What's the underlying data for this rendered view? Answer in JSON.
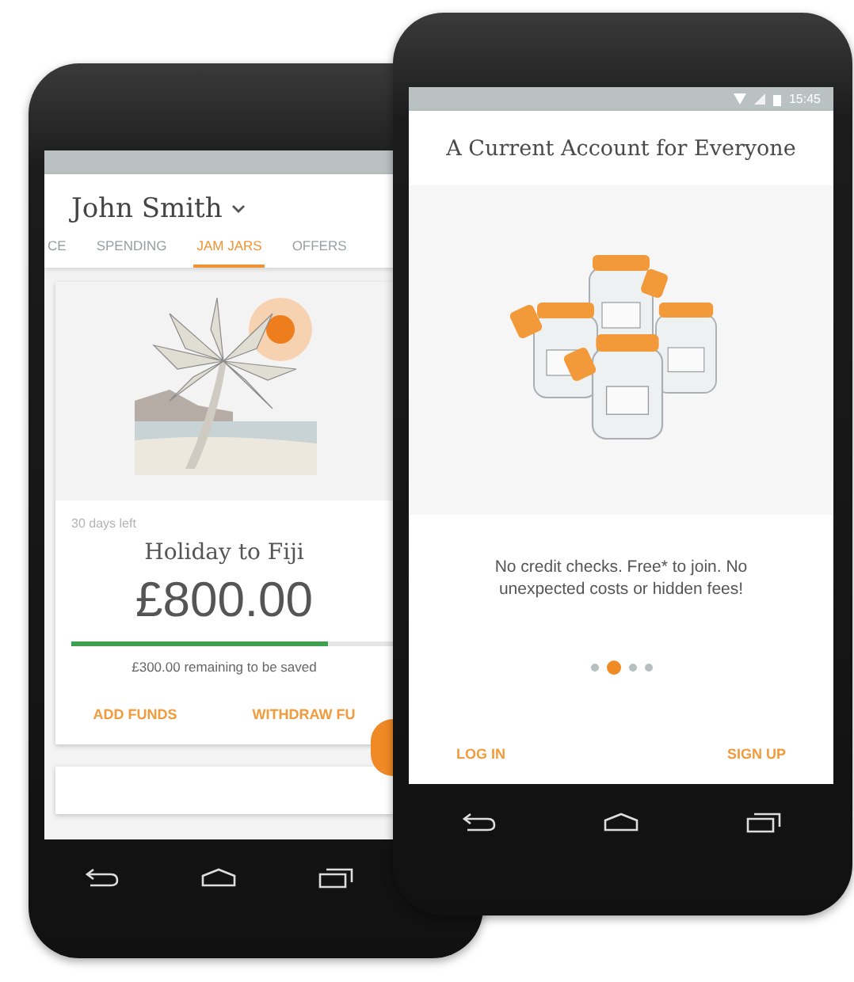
{
  "left_phone": {
    "account_name": "John Smith",
    "tabs": [
      {
        "label": "CE",
        "selected": false
      },
      {
        "label": "SPENDING",
        "selected": false
      },
      {
        "label": "JAM JARS",
        "selected": true
      },
      {
        "label": "OFFERS",
        "selected": false
      }
    ],
    "jar": {
      "days_left": "30 days left",
      "title": "Holiday to Fiji",
      "amount": "£800.00",
      "level": 0.8,
      "remaining": "£300.00 remaining to be saved",
      "actions": [
        "ADD FUNDS",
        "WITHDRAW FU"
      ]
    }
  },
  "right_phone": {
    "time": "15:45",
    "title": "A Current Account for Everyone",
    "message": "No credit checks. Free* to join. No unexpected costs or hidden fees!",
    "pages": [
      {
        "selected": false
      },
      {
        "selected": true
      },
      {
        "selected": false
      },
      {
        "selected": false
      }
    ],
    "actions": [
      "LOG IN",
      "SIGN UP"
    ]
  }
}
